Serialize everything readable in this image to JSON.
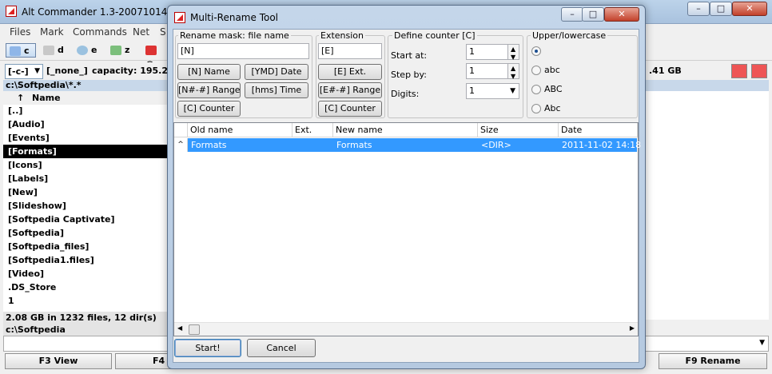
{
  "main": {
    "title": "Alt Commander 1.3-20071014",
    "menu": [
      "Files",
      "Mark",
      "Commands",
      "Net",
      "S"
    ],
    "drives": [
      "c",
      "d",
      "e",
      "z",
      "@"
    ],
    "drive_combo": "[-c-]",
    "volume_label": "[_none_]",
    "capacity_label": "capacity: 195.22",
    "right_free": ".41 GB",
    "left_path": "c:\\Softpedia\\*.*",
    "sort_arrow": "↑",
    "name_header": "Name",
    "files": [
      "[..]",
      "[Audio]",
      "[Events]",
      "[Formats]",
      "[Icons]",
      "[Labels]",
      "[New]",
      "[Slideshow]",
      "[Softpedia Captivate]",
      "[Softpedia]",
      "[Softpedia_files]",
      "[Softpedia1.files]",
      "[Video]",
      ".DS_Store",
      "1"
    ],
    "status": "2.08 GB in 1232 files, 12 dir(s)",
    "current_path": "c:\\Softpedia",
    "fkeys": [
      "F3 View",
      "F4",
      "F9 Rename"
    ]
  },
  "dialog": {
    "title": "Multi-Rename Tool",
    "mask_group": "Rename mask: file name",
    "mask_value": "[N]",
    "mask_buttons": [
      "[N] Name",
      "[YMD] Date",
      "[N#-#] Range",
      "[hms] Time",
      "[C] Counter"
    ],
    "ext_group": "Extension",
    "ext_value": "[E]",
    "ext_buttons": [
      "[E] Ext.",
      "[E#-#] Range",
      "[C] Counter"
    ],
    "counter_group": "Define counter [C]",
    "start_label": "Start at:",
    "start_value": "1",
    "step_label": "Step by:",
    "step_value": "1",
    "digits_label": "Digits:",
    "digits_value": "1",
    "case_group": "Upper/lowercase",
    "case_options": [
      "",
      "abc",
      "ABC",
      "Abc"
    ],
    "columns": [
      "Old name",
      "Ext.",
      "New name",
      "Size",
      "Date"
    ],
    "rows": [
      {
        "old": "Formats",
        "ext": "",
        "new": "Formats",
        "size": "<DIR>",
        "date": "2011-11-02 14:18"
      }
    ],
    "start_button": "Start!",
    "cancel_button": "Cancel"
  }
}
